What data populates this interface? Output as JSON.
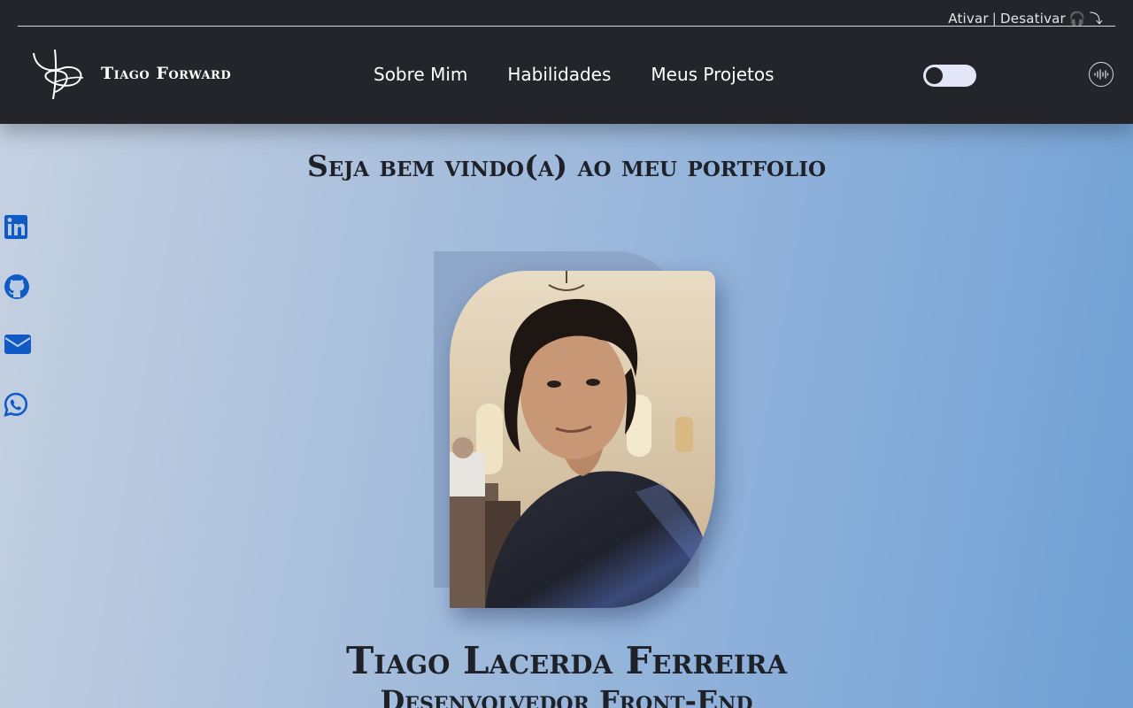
{
  "accessibility": {
    "activate_label": "Ativar",
    "separator": "|",
    "deactivate_label": "Desativar",
    "headphones_glyph": "🎧",
    "arrow_glyph": "⤵"
  },
  "header": {
    "brand": "Tiago Forward",
    "logo_icon": "tf-monogram-logo",
    "nav": [
      {
        "label": "Sobre Mim"
      },
      {
        "label": "Habilidades"
      },
      {
        "label": "Meus Projetos"
      }
    ],
    "theme_toggle_icon": "dark-mode-toggle",
    "audio_icon": "sound-wave-icon"
  },
  "social": [
    {
      "name": "linkedin",
      "icon": "linkedin-icon"
    },
    {
      "name": "github",
      "icon": "github-icon"
    },
    {
      "name": "email",
      "icon": "envelope-icon"
    },
    {
      "name": "whatsapp",
      "icon": "whatsapp-icon"
    }
  ],
  "hero": {
    "welcome": "Seja bem vindo(a) ao meu portfolio",
    "name": "Tiago Lacerda Ferreira",
    "role": "Desenvolvedor Front-End",
    "photo_icon": "profile-photo"
  },
  "colors": {
    "header_bg": "#23252b",
    "text_dark": "#1e2128",
    "social_blue": "#0f5ac7",
    "photo_accent": "#2f7fd8",
    "toggle_track": "#e3e5f9"
  }
}
